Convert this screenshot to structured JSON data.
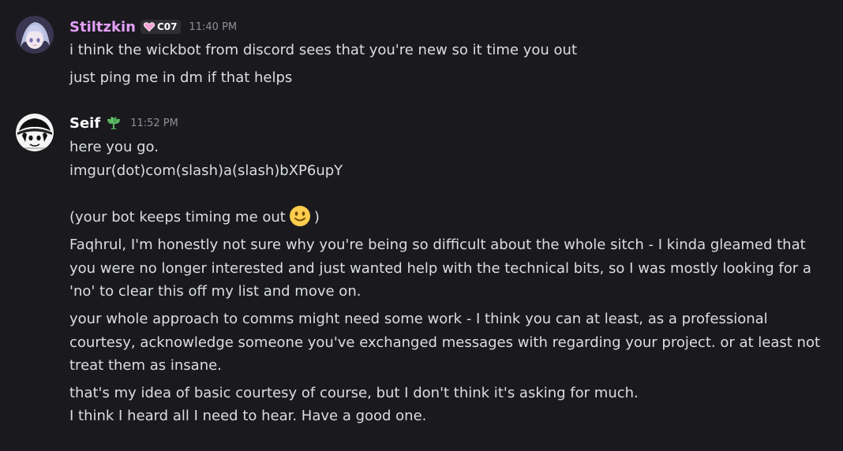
{
  "colors": {
    "background": "#1a1a1e",
    "stiltzkin_name": "#e39ff6",
    "seif_name": "#ffffff",
    "text": "#dbdee1",
    "timestamp": "#8d9098",
    "tag_bg": "#2e2e33",
    "leaf_badge": "#57b560"
  },
  "messages": [
    {
      "author": "Stiltzkin",
      "tag": "C07",
      "tag_icon": "heart-icon",
      "time": "11:40 PM",
      "lines": [
        "i think the wickbot from discord sees that you're new so it time you out",
        "just ping me in dm if that helps"
      ]
    },
    {
      "author": "Seif",
      "badge_icon": "leaf-badge-icon",
      "time": "11:52 PM",
      "lines": [
        "here you go.",
        "imgur(dot)com(slash)a(slash)bXP6upY",
        "(your bot keeps timing me out",
        ")",
        "Faqhrul, I'm honestly not sure why you're being so difficult about the whole sitch - I kinda gleamed that you were no longer interested and just wanted help with the technical bits, so I was mostly looking for a 'no' to clear this off my list and move on.",
        "your whole approach to comms might need some work - I think you can at least, as a professional courtesy, acknowledge someone you've exchanged messages with regarding your project. or at least not treat them as insane.",
        "that's my idea of basic courtesy of course, but I don't think it's asking for much.",
        "I think I heard all I need to hear. Have a good one."
      ]
    }
  ]
}
